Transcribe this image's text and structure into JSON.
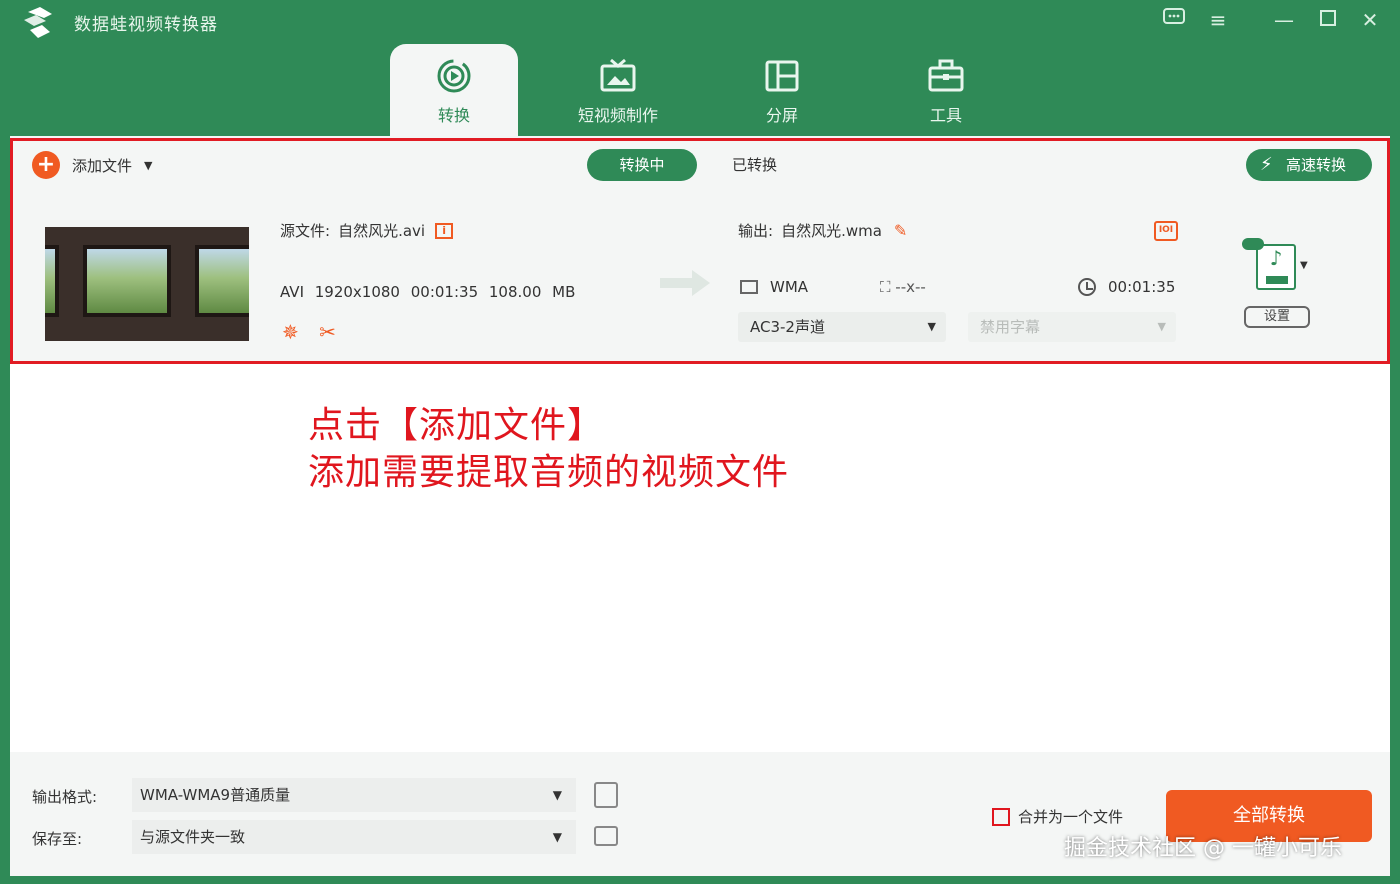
{
  "window": {
    "title": "数据蛙视频转换器",
    "controls": [
      "feedback-icon",
      "menu-icon",
      "minimize-icon",
      "maximize-icon",
      "close-icon"
    ]
  },
  "tabs": [
    {
      "label": "转换",
      "icon": "convert-icon",
      "active": true
    },
    {
      "label": "短视频制作",
      "icon": "tv-icon",
      "active": false
    },
    {
      "label": "分屏",
      "icon": "split-screen-icon",
      "active": false
    },
    {
      "label": "工具",
      "icon": "toolbox-icon",
      "active": false
    }
  ],
  "toolbar": {
    "add_file": "添加文件",
    "seg_converting": "转换中",
    "seg_converted": "已转换",
    "fast_convert": "高速转换"
  },
  "file": {
    "source_label": "源文件:",
    "source_name": "自然风光.avi",
    "meta": "AVI 1920x1080 00:01:35 108.00 MB",
    "output_label": "输出:",
    "output_name": "自然风光.wma",
    "format": "WMA",
    "resolution": "--x--",
    "duration": "00:01:35",
    "audio_track": "AC3-2声道",
    "subtitle": "禁用字幕",
    "settings": "设置",
    "hw_badge": "IOI"
  },
  "annotation": {
    "line1": "点击【添加文件】",
    "line2": "添加需要提取音频的视频文件"
  },
  "bottom": {
    "format_label": "输出格式:",
    "format_value": "WMA-WMA9普通质量",
    "save_label": "保存至:",
    "save_value": "与源文件夹一致",
    "merge_label": "合并为一个文件",
    "convert_all": "全部转换"
  },
  "watermark": "掘金技术社区 @ 一罐小可乐",
  "colors": {
    "brand_green": "#2f8a57",
    "accent_orange": "#f05a22",
    "annotation_red": "#e0161e"
  }
}
